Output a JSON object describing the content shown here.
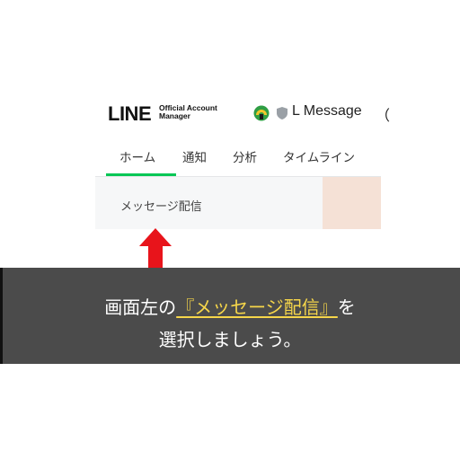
{
  "header": {
    "logo_text": "LINE",
    "logo_sub_line1": "Official Account",
    "logo_sub_line2": "Manager",
    "account_icon": "account-avatar-icon",
    "shield_icon": "shield-icon",
    "account_name": "L Message",
    "account_paren": "（"
  },
  "tabs": [
    {
      "label": "ホーム",
      "active": true
    },
    {
      "label": "通知",
      "active": false
    },
    {
      "label": "分析",
      "active": false
    },
    {
      "label": "タイムライン",
      "active": false
    }
  ],
  "sidebar": {
    "items": [
      {
        "label": "メッセージ配信"
      }
    ]
  },
  "caption": {
    "line1_before": "画面左の",
    "line1_highlight": "『メッセージ配信』",
    "line1_after": "を",
    "line2": "選択しましょう。"
  },
  "colors": {
    "accent": "#06c755",
    "arrow": "#e8141b",
    "caption_bg": "#4b4b4b",
    "highlight": "#f6d64a",
    "content_peach": "#f5e1d6"
  }
}
